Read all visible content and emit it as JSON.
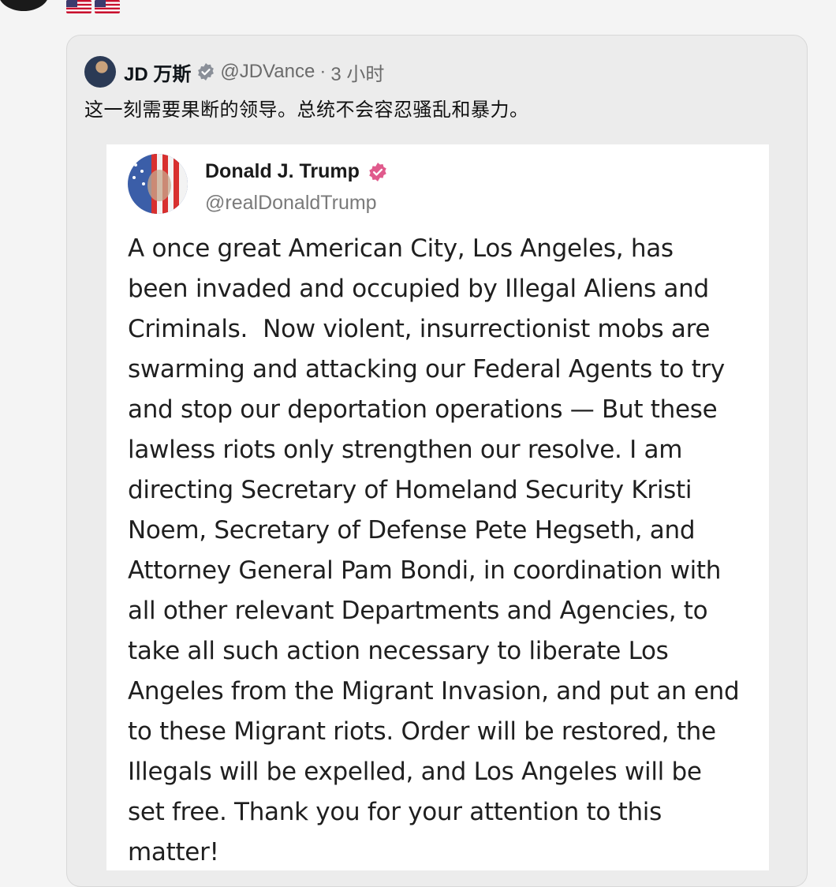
{
  "quote_post": {
    "author_name": "JD 万斯",
    "handle": "@JDVance",
    "separator": "·",
    "time": "3 小时",
    "text": "这一刻需要果断的领导。总统不会容忍骚乱和暴力。"
  },
  "embedded_post": {
    "author_name": "Donald J. Trump",
    "handle": "@realDonaldTrump",
    "body_lines": [
      "A once great American City, Los Angeles, has",
      "been invaded and occupied by Illegal Aliens and",
      "Criminals.  Now violent, insurrectionist mobs are",
      "swarming and attacking our Federal Agents to try",
      "and stop our deportation operations — But these",
      "lawless riots only strengthen our resolve. I am",
      "directing Secretary of Homeland Security Kristi",
      "Noem, Secretary of Defense Pete Hegseth, and",
      "Attorney General Pam Bondi, in coordination with",
      "all other relevant Departments and Agencies, to",
      "take all such action necessary to liberate Los",
      "Angeles from the Migrant Invasion, and put an end",
      "to these Migrant riots. Order will be restored, the",
      "Illegals will be expelled, and Los Angeles will be",
      "set free. Thank you for your attention to this",
      "matter!"
    ]
  },
  "icons": {
    "top_flags": "us-flag-icon",
    "verified_gray": "verified-badge-gray-icon",
    "verified_pink": "verified-badge-pink-icon"
  },
  "colors": {
    "background": "#f4f4f4",
    "card": "#ececec",
    "embed": "#ffffff",
    "verified_pink": "#e05a8c",
    "verified_gray": "#8a8f98"
  }
}
